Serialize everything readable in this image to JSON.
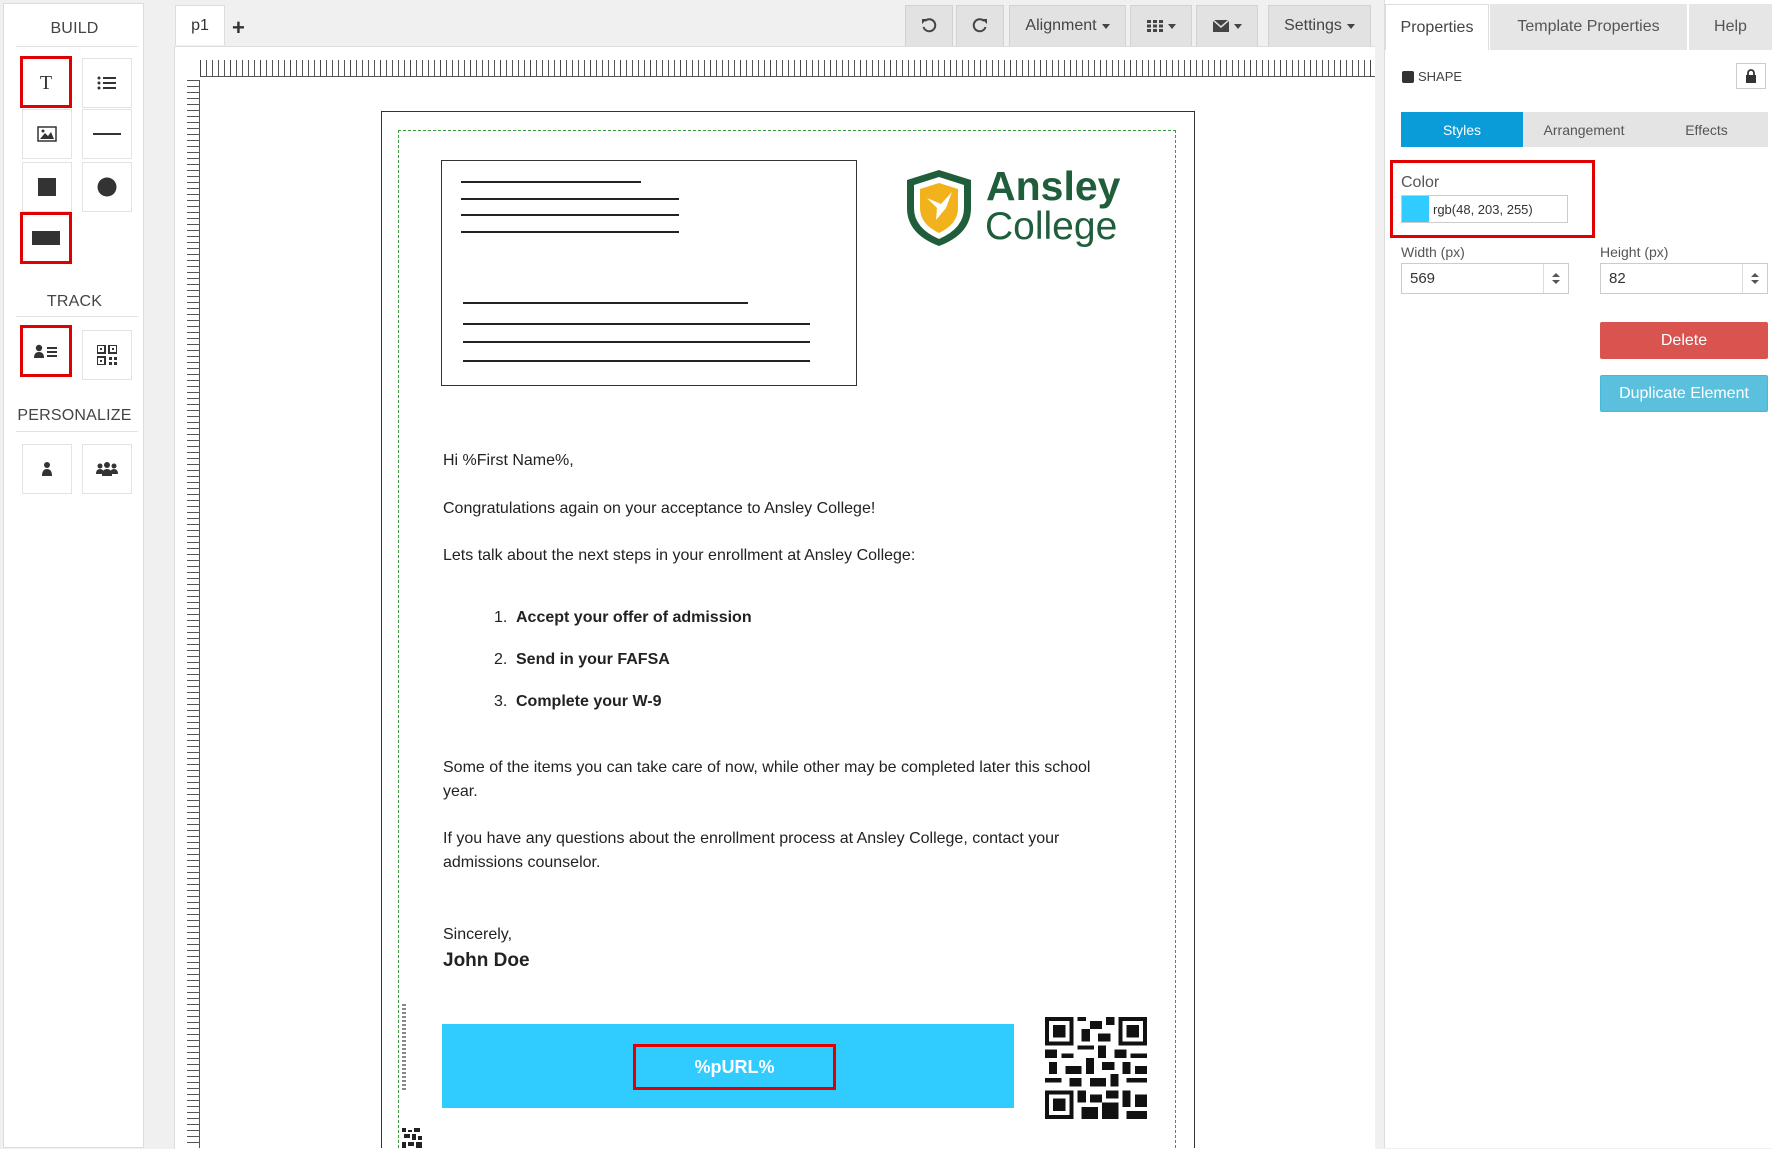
{
  "toolbox": {
    "build_title": "BUILD",
    "track_title": "TRACK",
    "personalize_title": "PERSONALIZE",
    "tools": [
      "text-tool",
      "list-tool",
      "image-tool",
      "line-tool",
      "square-tool",
      "circle-tool",
      "rectangle-tool",
      "personal-url-tool",
      "qr-code-tool",
      "person-tool",
      "group-tool"
    ]
  },
  "editor": {
    "page_tab": "p1",
    "add_tab": "+",
    "alignment_label": "Alignment",
    "settings_label": "Settings"
  },
  "letter": {
    "logo_name": "Ansley",
    "logo_sub": "College",
    "greeting": "Hi %First Name%,",
    "p1": "Congratulations again on your acceptance to Ansley College!",
    "p2": "Lets talk about the next steps in your enrollment at Ansley College:",
    "steps": [
      "Accept your offer of admission",
      "Send in your FAFSA",
      "Complete your W-9"
    ],
    "step_nums": [
      "1.",
      "2.",
      "3."
    ],
    "p3_line1": "Some of the items you can take care of now, while other may be completed later this school",
    "p3_line2": "year.",
    "p4_line1": "If you have any questions about the enrollment process at Ansley College, contact your",
    "p4_line2": "admissions counselor.",
    "closing": "Sincerely,",
    "signature": "John Doe",
    "purl": "%pURL%"
  },
  "properties": {
    "tabs": [
      "Properties",
      "Template Properties",
      "Help"
    ],
    "element_type": "SHAPE",
    "subtabs": [
      "Styles",
      "Arrangement",
      "Effects"
    ],
    "color_label": "Color",
    "color_value": "rgb(48, 203, 255)",
    "color_hex": "#30cbff",
    "width_label": "Width (px)",
    "width_value": "569",
    "height_label": "Height (px)",
    "height_value": "82",
    "delete_label": "Delete",
    "duplicate_label": "Duplicate Element"
  }
}
